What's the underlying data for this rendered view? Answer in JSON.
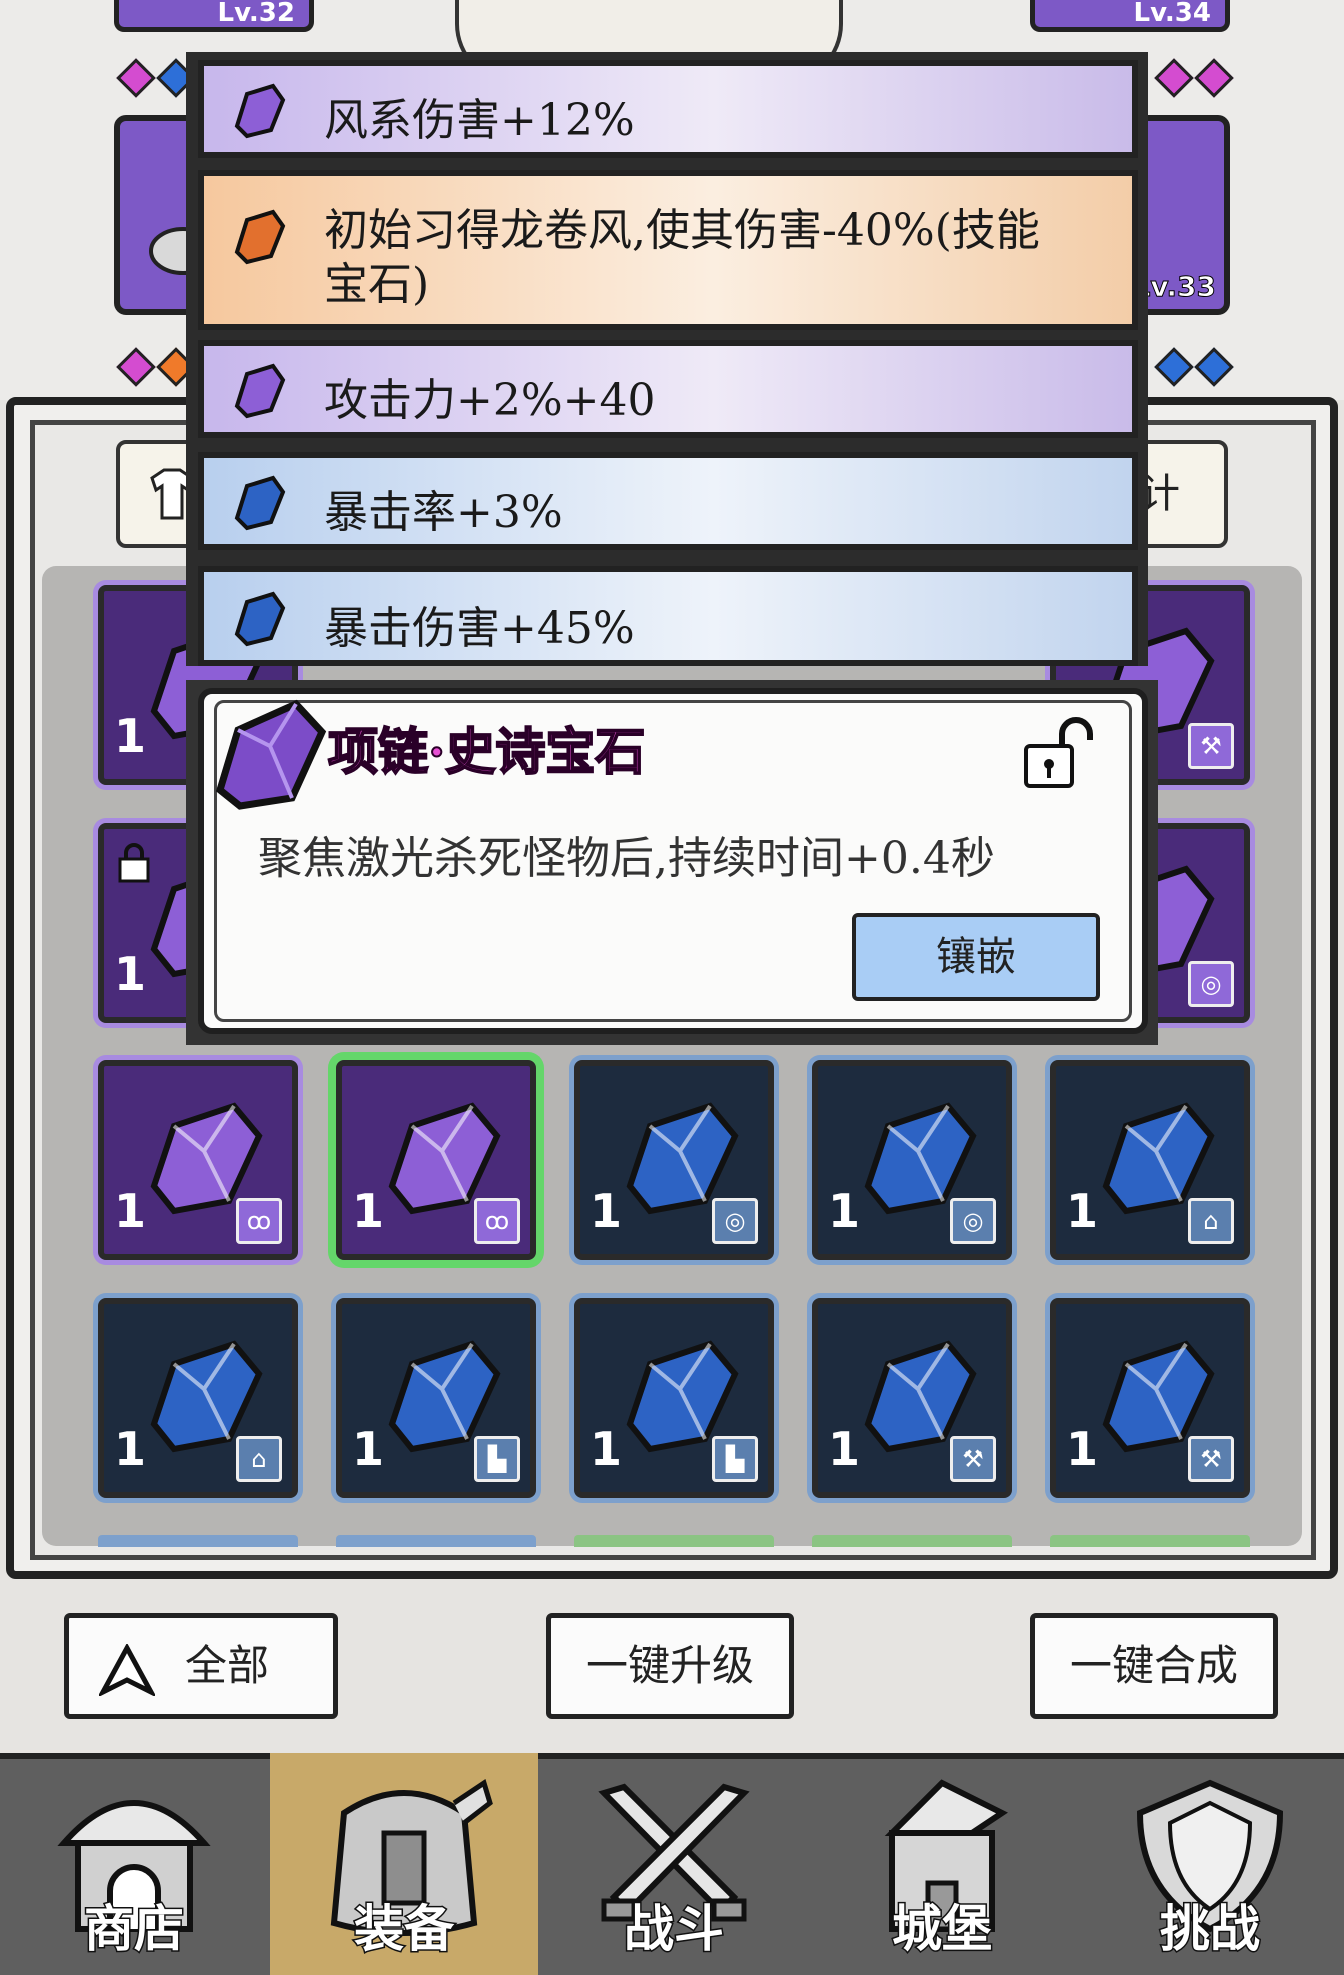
{
  "top": {
    "left_level": "Lv.32",
    "right_level": "Lv.34",
    "slot_right_level": "Lv.33"
  },
  "tabs": {
    "right_tab_partial": "计"
  },
  "gem_stats": [
    {
      "text": "风系伤害+12%",
      "rarity": "purple"
    },
    {
      "text": "初始习得龙卷风,使其伤害-40%(技能",
      "text2": "宝石)",
      "rarity": "orange"
    },
    {
      "text": "攻击力+2%+40",
      "rarity": "purple"
    },
    {
      "text": "暴击率+3%",
      "rarity": "blue"
    },
    {
      "text": "暴击伤害+45%",
      "rarity": "blue"
    }
  ],
  "popup": {
    "title": "项链·史诗宝石",
    "description": "聚焦激光杀死怪物后,持续时间+0.4秒",
    "embed_button": "镶嵌"
  },
  "inventory": {
    "row3": [
      {
        "count": "1",
        "rarity": "purple",
        "slot": "necklace",
        "selected": false
      },
      {
        "count": "1",
        "rarity": "purple",
        "slot": "necklace",
        "selected": true
      },
      {
        "count": "1",
        "rarity": "blue",
        "slot": "ring",
        "selected": false
      },
      {
        "count": "1",
        "rarity": "blue",
        "slot": "ring",
        "selected": false
      },
      {
        "count": "1",
        "rarity": "blue",
        "slot": "armor",
        "selected": false
      }
    ],
    "row4": [
      {
        "count": "1",
        "rarity": "blue",
        "slot": "armor"
      },
      {
        "count": "1",
        "rarity": "blue",
        "slot": "boots"
      },
      {
        "count": "1",
        "rarity": "blue",
        "slot": "boots"
      },
      {
        "count": "1",
        "rarity": "blue",
        "slot": "weapon"
      },
      {
        "count": "1",
        "rarity": "blue",
        "slot": "weapon"
      }
    ],
    "partial_left_counts": [
      "1",
      "1"
    ]
  },
  "buttons": {
    "filter_all": "全部",
    "upgrade_all": "一键升级",
    "merge_all": "一键合成"
  },
  "nav": [
    {
      "label": "商店",
      "active": false
    },
    {
      "label": "装备",
      "active": true
    },
    {
      "label": "战斗",
      "active": false
    },
    {
      "label": "城堡",
      "active": false
    },
    {
      "label": "挑战",
      "active": false
    }
  ],
  "colors": {
    "epic_purple": "#7d59c6",
    "rare_blue": "#5b7fae",
    "title_pink": "#e64fd2",
    "embed_button": "#a9cdf5",
    "selected_green": "#64d66a",
    "nav_active": "#c8a969"
  }
}
